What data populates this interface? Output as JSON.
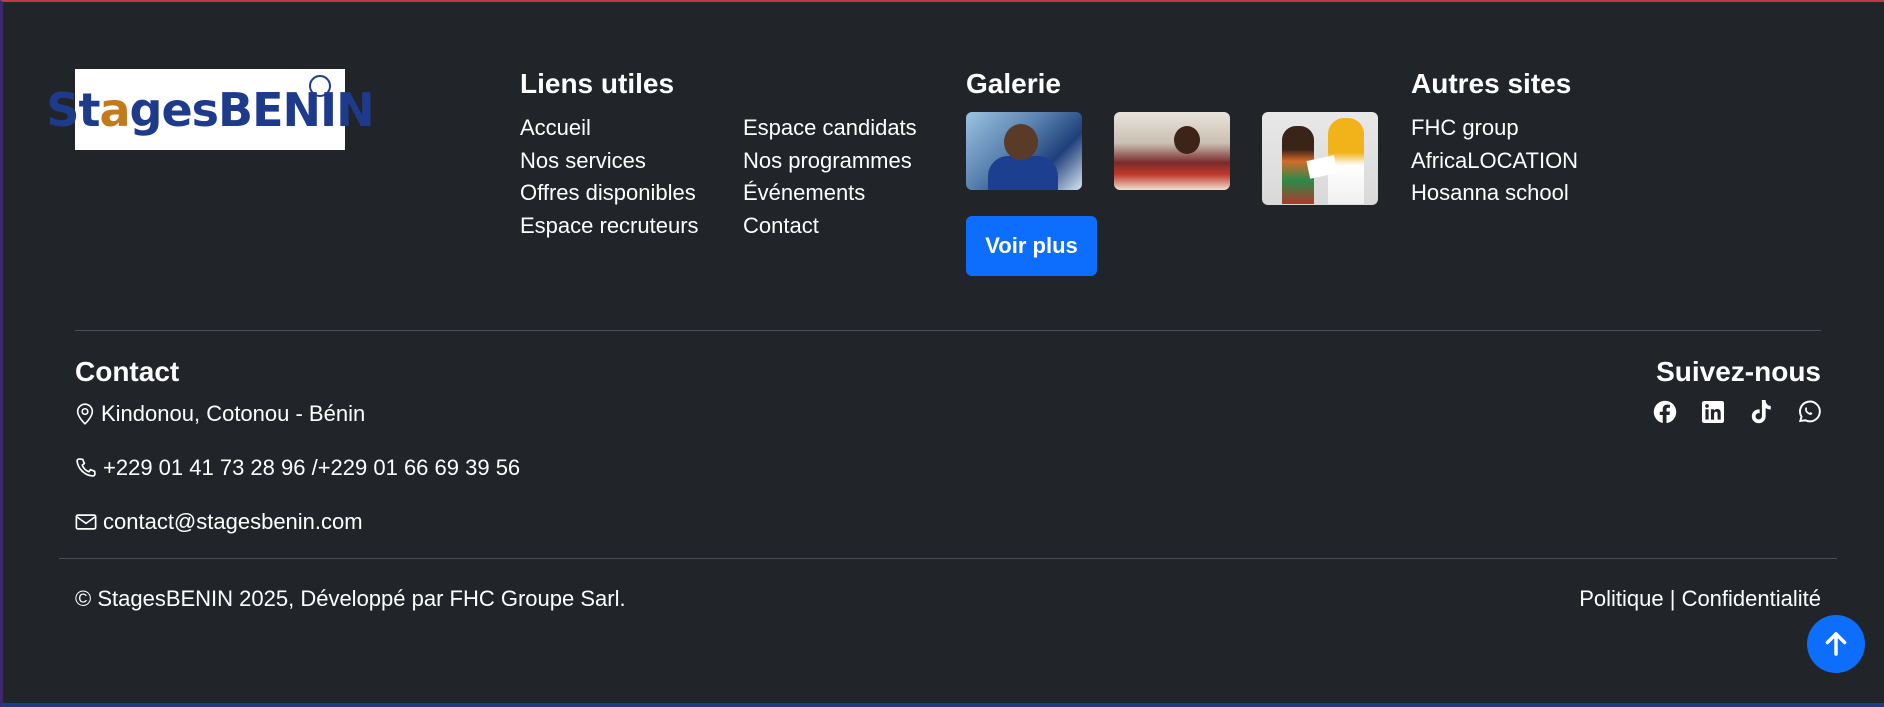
{
  "brand": {
    "logo_text_part1": "St",
    "logo_text_i": "a",
    "logo_text_part2": "ges",
    "logo_text_part3": "BENIN"
  },
  "useful_links": {
    "title": "Liens utiles",
    "col1": [
      "Accueil",
      "Nos services",
      "Offres disponibles",
      "Espace recruteurs"
    ],
    "col2": [
      "Espace candidats",
      "Nos programmes",
      "Événements",
      "Contact"
    ]
  },
  "gallery": {
    "title": "Galerie",
    "button_label": "Voir plus"
  },
  "other_sites": {
    "title": "Autres sites",
    "items": [
      "FHC group",
      "AfricaLOCATION",
      "Hosanna school"
    ]
  },
  "contact": {
    "title": "Contact",
    "address": "Kindonou, Cotonou - Bénin",
    "phone": "+229 01 41 73 28 96 /+229 01 66 69 39 56",
    "email": "contact@stagesbenin.com"
  },
  "social": {
    "title": "Suivez-nous",
    "icons": [
      "facebook-icon",
      "linkedin-icon",
      "tiktok-icon",
      "whatsapp-icon"
    ]
  },
  "footer": {
    "copyright": "© StagesBENIN 2025, Développé par FHC Groupe Sarl.",
    "politique": "Politique",
    "separator": "|",
    "confidentialite": "Confidentialité"
  },
  "colors": {
    "background": "#212529",
    "accent": "#0d6efd",
    "text": "#ffffff"
  }
}
